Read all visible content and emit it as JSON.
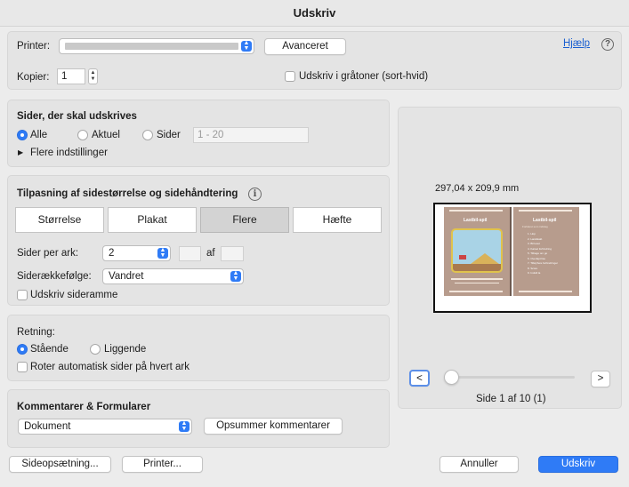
{
  "window": {
    "title": "Udskriv"
  },
  "printer": {
    "label": "Printer:",
    "selected": "",
    "advanced_label": "Avanceret",
    "help_label": "Hjælp",
    "help_icon": "?"
  },
  "copies": {
    "label": "Kopier:",
    "value": "1",
    "grayscale_label": "Udskriv i gråtoner (sort-hvid)",
    "grayscale_checked": false
  },
  "pages": {
    "title": "Sider, der skal udskrives",
    "options": [
      {
        "label": "Alle",
        "selected": true
      },
      {
        "label": "Aktuel",
        "selected": false
      },
      {
        "label": "Sider",
        "selected": false
      }
    ],
    "range_placeholder": "1 - 20",
    "more_label": "Flere indstillinger"
  },
  "sizing": {
    "title": "Tilpasning af sidestørrelse og sidehåndtering",
    "info_icon": "i",
    "tabs": [
      {
        "label": "Størrelse",
        "selected": false
      },
      {
        "label": "Plakat",
        "selected": false
      },
      {
        "label": "Flere",
        "selected": true
      },
      {
        "label": "Hæfte",
        "selected": false
      }
    ],
    "pages_per_sheet_label": "Sider per ark:",
    "pages_per_sheet_value": "2",
    "of_label": "af",
    "order_label": "Siderækkefølge:",
    "order_value": "Vandret",
    "border_label": "Udskriv sideramme",
    "border_checked": false
  },
  "orientation": {
    "title": "Retning:",
    "options": [
      {
        "label": "Stående",
        "selected": true
      },
      {
        "label": "Liggende",
        "selected": false
      }
    ],
    "auto_rotate_label": "Roter automatisk sider på hvert ark",
    "auto_rotate_checked": false
  },
  "comments": {
    "title": "Kommentarer & Formularer",
    "value": "Dokument",
    "summarize_label": "Opsummer kommentarer"
  },
  "preview": {
    "dimensions": "297,04 x 209,9 mm",
    "prev_label": "<",
    "next_label": ">",
    "page_status": "Side 1 af 10 (1)",
    "slider_position": 0,
    "left_page_title": "Lastbil-spil",
    "right_page_title": "Lastbil-spil",
    "right_page_subtitle": "Forklaret som indslag",
    "right_page_items": [
      "1. Hop",
      "2. Landskab",
      "3. Bil leset",
      "4. Kørsel forhindring",
      "5. Tilbage om go",
      "6. Overlapt lise",
      "7. Tilføj flere forhindringer",
      "8. Score",
      "9. Indstil la"
    ],
    "colors": {
      "page": "#b79c8d",
      "sky": "#a9d3e6",
      "hill": "#d9b25a"
    }
  },
  "footer": {
    "page_setup_label": "Sideopsætning...",
    "printer_label": "Printer...",
    "cancel_label": "Annuller",
    "print_label": "Udskriv"
  },
  "colors": {
    "accent": "#2f7bf6",
    "link": "#1a5fd0"
  }
}
